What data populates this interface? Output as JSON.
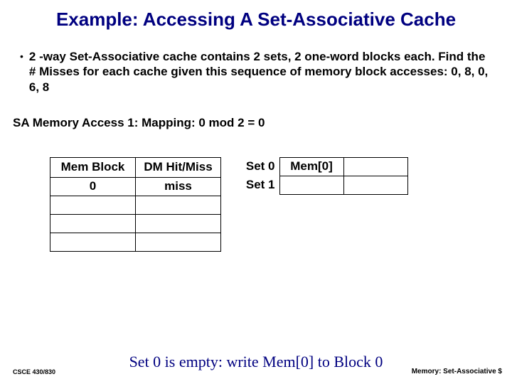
{
  "title": "Example: Accessing A Set-Associative Cache",
  "bullet": "2 -way Set-Associative cache contains 2 sets, 2 one-word blocks each. Find the # Misses for each cache given this sequence of memory block accesses: 0, 8, 0, 6, 8",
  "subline": "SA Memory Access 1:  Mapping: 0 mod 2 = 0",
  "left_table": {
    "headers": [
      "Mem Block",
      "DM Hit/Miss"
    ],
    "rows": [
      [
        "0",
        "miss"
      ],
      [
        "",
        ""
      ],
      [
        "",
        ""
      ],
      [
        "",
        ""
      ]
    ]
  },
  "right_table": {
    "rows": [
      {
        "label": "Set 0",
        "cells": [
          "Mem[0]",
          ""
        ]
      },
      {
        "label": "Set 1",
        "cells": [
          "",
          ""
        ]
      }
    ]
  },
  "caption": "Set 0 is empty: write Mem[0] to Block 0",
  "footer_left": "CSCE 430/830",
  "footer_right": "Memory: Set-Associative $"
}
